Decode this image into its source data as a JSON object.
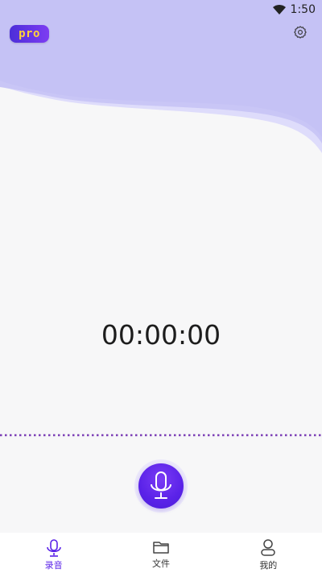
{
  "status_bar": {
    "time": "1:50"
  },
  "header": {
    "pro_label": "pro"
  },
  "recorder": {
    "timer": "00:00:00"
  },
  "tabs": [
    {
      "label": "录音",
      "icon": "mic-icon",
      "active": true
    },
    {
      "label": "文件",
      "icon": "folder-icon",
      "active": false
    },
    {
      "label": "我的",
      "icon": "user-icon",
      "active": false
    }
  ],
  "colors": {
    "accent": "#5a22e8",
    "header_bg": "#c5c2f5",
    "header_wave_light": "#dedcfb",
    "pro_text": "#ffd23a",
    "divider_dots": "#7b3fb5"
  }
}
